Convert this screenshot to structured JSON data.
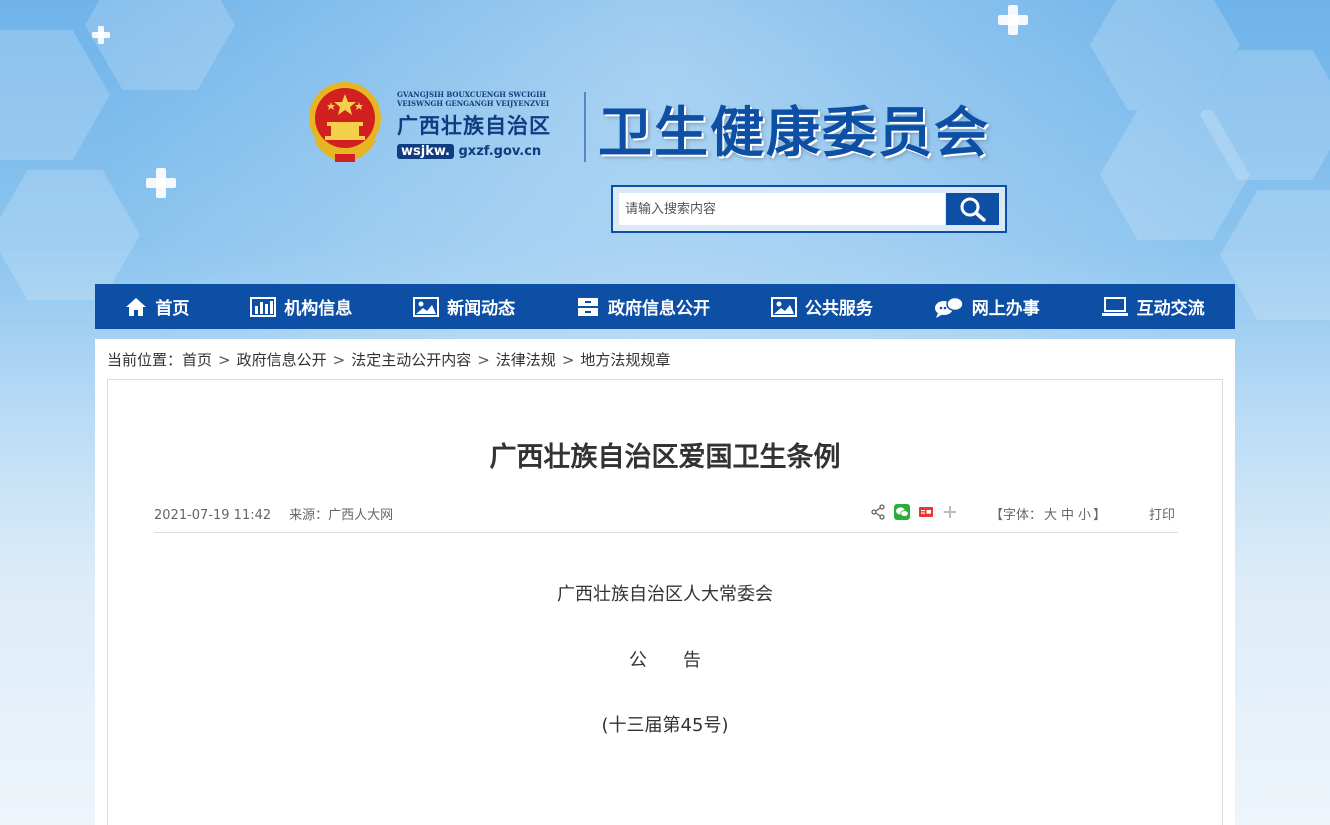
{
  "header": {
    "pinyin_line1": "GVANGJSIH BOUXCUENGH SWCIGIH",
    "pinyin_line2": "VEISWNGH GENGANGH VEIJYENZVEI",
    "region_name": "广西壮族自治区",
    "url_prefix": "wsjkw.",
    "url_suffix": "gxzf.gov.cn",
    "site_title": "卫生健康委员会"
  },
  "search": {
    "placeholder": "请输入搜索内容"
  },
  "nav": {
    "items": [
      {
        "label": "首页",
        "icon": "home-icon"
      },
      {
        "label": "机构信息",
        "icon": "bar-chart-icon"
      },
      {
        "label": "新闻动态",
        "icon": "image-icon"
      },
      {
        "label": "政府信息公开",
        "icon": "cabinet-icon"
      },
      {
        "label": "公共服务",
        "icon": "image-icon"
      },
      {
        "label": "网上办事",
        "icon": "chat-icon"
      },
      {
        "label": "互动交流",
        "icon": "monitor-icon"
      }
    ]
  },
  "breadcrumb": {
    "prefix": "当前位置：",
    "items": [
      "首页",
      "政府信息公开",
      "法定主动公开内容",
      "法律法规",
      "地方法规规章"
    ],
    "separator": ">"
  },
  "article": {
    "title": "广西壮族自治区爱国卫生条例",
    "date": "2021-07-19 11:42",
    "source": "来源：广西人大网",
    "fontsize_prefix": "【字体：",
    "fontsize_large": "大",
    "fontsize_medium": "中",
    "fontsize_small": "小",
    "fontsize_suffix": "】",
    "print": "打印",
    "share_icons": [
      "share-icon",
      "wechat-icon",
      "toutiao-icon",
      "plus-icon"
    ],
    "paragraphs": [
      "广西壮族自治区人大常委会",
      "公　　告",
      "(十三届第45号)"
    ]
  },
  "colors": {
    "brand_blue": "#0e4fa6",
    "text": "#333333",
    "meta_text": "#666666"
  }
}
